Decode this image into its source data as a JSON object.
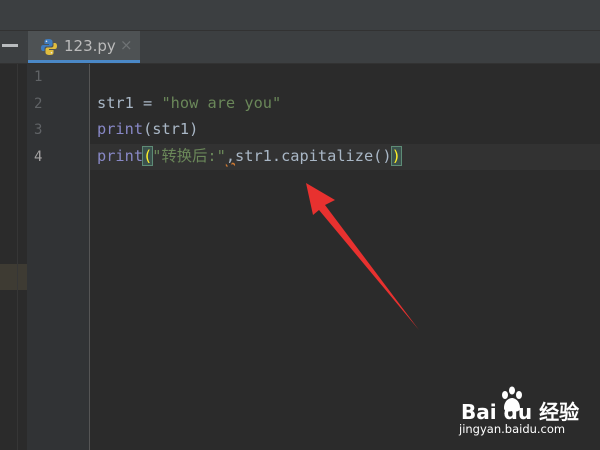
{
  "editor": {
    "tab": {
      "filename": "123.py",
      "close": "×",
      "icon": "python-file-icon"
    },
    "line_numbers": [
      "1",
      "2",
      "3",
      "4"
    ],
    "code_lines": [
      {
        "parts": []
      },
      {
        "parts": [
          {
            "text": "str1 = ",
            "kind": "plain"
          },
          {
            "text": "\"how are you\"",
            "kind": "string"
          }
        ]
      },
      {
        "parts": [
          {
            "text": "print",
            "kind": "builtin"
          },
          {
            "text": "(str1)",
            "kind": "plain"
          }
        ]
      },
      {
        "parts": [
          {
            "text": "print",
            "kind": "builtin"
          },
          {
            "text": "(",
            "kind": "brace"
          },
          {
            "text": "\"转换后:\"",
            "kind": "string"
          },
          {
            "text": ",",
            "kind": "typo"
          },
          {
            "text": "str1.capitalize()",
            "kind": "plain"
          },
          {
            "text": ")",
            "kind": "brace"
          }
        ]
      }
    ]
  },
  "watermark": {
    "brand": "Bai du 经验",
    "url": "jingyan.baidu.com"
  },
  "colors": {
    "background": "#2b2b2b",
    "gutter": "#313335",
    "keyword": "#8888c6",
    "string": "#6a8759",
    "text": "#a9b7c6",
    "arrow": "#e8312f",
    "tab_underline": "#4a88c7"
  }
}
